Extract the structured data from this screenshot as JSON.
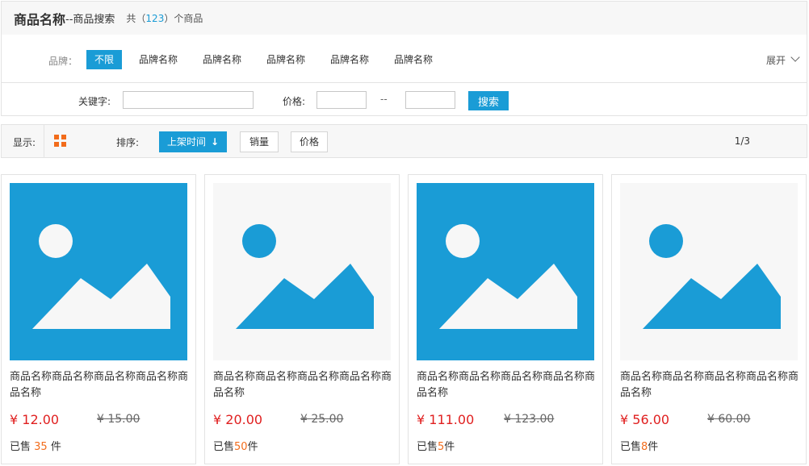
{
  "header": {
    "title": "商品名称",
    "subtitle": "--商品搜索",
    "count_prefix": "共（",
    "count": "123",
    "count_suffix": "）个商品"
  },
  "brand_filter": {
    "label": "品牌：",
    "items": [
      {
        "label": "不限",
        "active": true
      },
      {
        "label": "品牌名称",
        "active": false
      },
      {
        "label": "品牌名称",
        "active": false
      },
      {
        "label": "品牌名称",
        "active": false
      },
      {
        "label": "品牌名称",
        "active": false
      },
      {
        "label": "品牌名称",
        "active": false
      }
    ],
    "expand_label": "展开",
    "expand_icon": "chevron-down-icon"
  },
  "search": {
    "keyword_label": "关键字:",
    "keyword_value": "",
    "price_label": "价格:",
    "price_min": "",
    "price_separator": "--",
    "price_max": "",
    "button_label": "搜索"
  },
  "toolbar": {
    "display_label": "显示:",
    "display_icon": "grid-view-icon",
    "sort_label": "排序:",
    "sort_options": [
      {
        "label": "上架时间",
        "active": true,
        "icon": "arrow-down-icon"
      },
      {
        "label": "销量",
        "active": false
      },
      {
        "label": "价格",
        "active": false
      }
    ],
    "page_indicator": "1/3"
  },
  "products": [
    {
      "name": "商品名称商品名称商品名称商品名称商品名称",
      "price": "¥ 12.00",
      "old_price": "¥ 15.00",
      "sold_prefix": "已售 ",
      "sold_count": "35",
      "sold_suffix": " 件",
      "image_style": "filled"
    },
    {
      "name": "商品名称商品名称商品名称商品名称商品名称",
      "price": "¥ 20.00",
      "old_price": "¥ 25.00",
      "sold_prefix": "已售",
      "sold_count": "50",
      "sold_suffix": "件",
      "image_style": "light"
    },
    {
      "name": "商品名称商品名称商品名称商品名称商品名称",
      "price": "¥ 111.00",
      "old_price": "¥ 123.00",
      "sold_prefix": "已售",
      "sold_count": "5",
      "sold_suffix": "件",
      "image_style": "filled"
    },
    {
      "name": "商品名称商品名称商品名称商品名称商品名称",
      "price": "¥ 56.00",
      "old_price": "¥ 60.00",
      "sold_prefix": "已售",
      "sold_count": "8",
      "sold_suffix": "件",
      "image_style": "light"
    }
  ],
  "colors": {
    "accent": "#1a9cd6",
    "price": "#e02020",
    "highlight": "#f26c1b"
  }
}
